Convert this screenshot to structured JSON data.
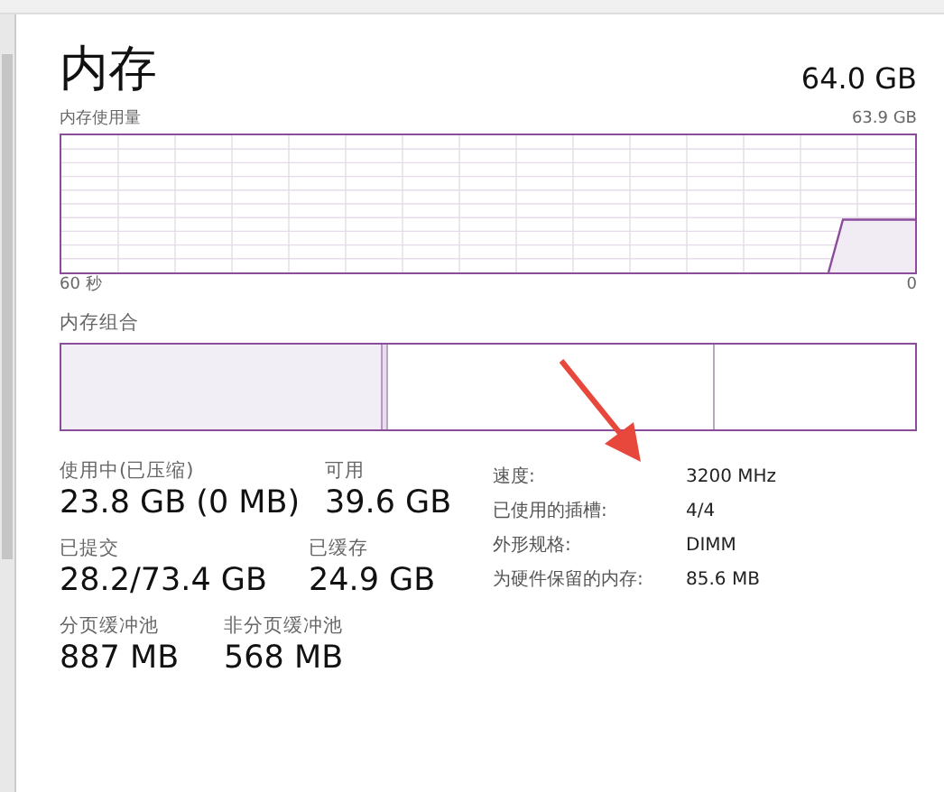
{
  "title": "内存",
  "total": "64.0 GB",
  "usage_graph": {
    "label": "内存使用量",
    "max": "63.9 GB",
    "x_start": "60 秒",
    "x_end": "0"
  },
  "composition": {
    "label": "内存组合",
    "in_use": {
      "level": 0.376
    }
  },
  "stat_rows": [
    [
      {
        "label": "使用中(已压缩)",
        "value": "23.8 GB (0 MB)"
      },
      {
        "label": "可用",
        "value": "39.6 GB"
      }
    ],
    [
      {
        "label": "已提交",
        "value": "28.2/73.4 GB"
      },
      {
        "label": "已缓存",
        "value": "24.9 GB"
      }
    ],
    [
      {
        "label": "分页缓冲池",
        "value": "887 MB"
      },
      {
        "label": "非分页缓冲池",
        "value": "568 MB"
      }
    ]
  ],
  "properties": [
    {
      "label": "速度:",
      "value": "3200 MHz"
    },
    {
      "label": "已使用的插槽:",
      "value": "4/4"
    },
    {
      "label": "外形规格:",
      "value": "DIMM"
    },
    {
      "label": "为硬件保留的内存:",
      "value": "85.6 MB"
    }
  ]
}
